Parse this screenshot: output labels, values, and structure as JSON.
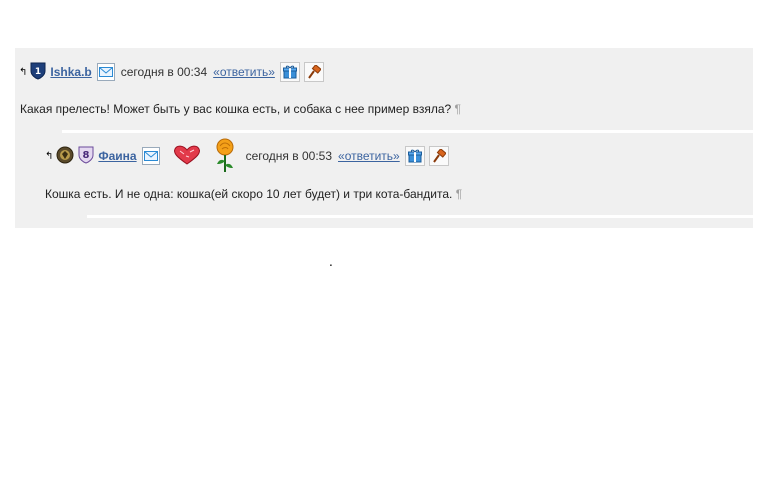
{
  "comments": [
    {
      "arrow": "↰",
      "rank_badge": "1",
      "username": "Ishka.b",
      "time": "сегодня в 00:34",
      "reply_label": "«ответить»",
      "text": "Какая прелесть! Может быть у вас кошка есть, и собака с нее пример взяла?",
      "pilcrow": "¶",
      "icons": [
        "shield-icon",
        "mail-icon",
        "gift-icon",
        "hammer-icon"
      ]
    },
    {
      "arrow": "↰",
      "rank_badge": "8",
      "username": "Фаина",
      "time": "сегодня в 00:53",
      "reply_label": "«ответить»",
      "text": "Кошка есть. И не одна: кошка(ей скоро 10 лет будет) и три кота-бандита.",
      "pilcrow": "¶",
      "icons": [
        "emblem-icon",
        "shield-icon",
        "mail-icon",
        "heart-gift-icon",
        "rose-gift-icon",
        "gift-icon",
        "hammer-icon"
      ]
    }
  ],
  "stray_dot": "."
}
